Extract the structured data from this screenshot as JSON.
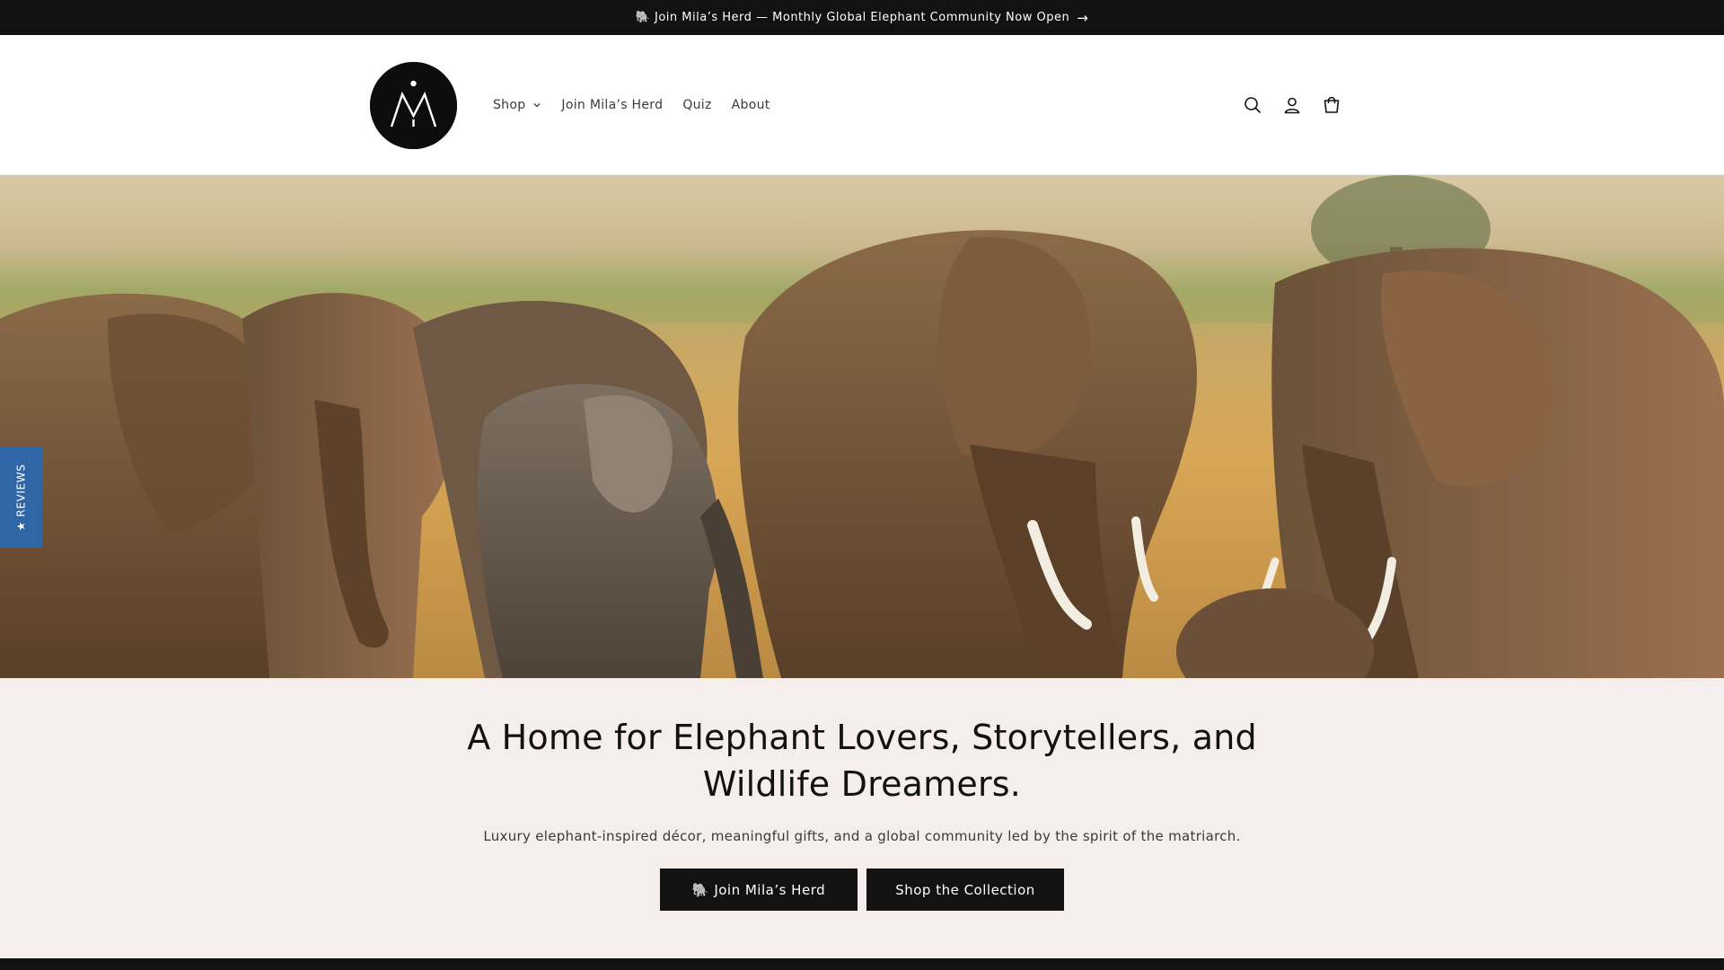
{
  "announcement": {
    "icon": "elephant-icon",
    "text": "🐘 Join Mila’s Herd — Monthly Global Elephant Community Now Open",
    "arrow": "→"
  },
  "header": {
    "logo_alt": "logo",
    "nav": [
      {
        "label": "Shop",
        "has_dropdown": true
      },
      {
        "label": "Join Mila’s Herd"
      },
      {
        "label": "Quiz"
      },
      {
        "label": "About"
      }
    ],
    "icons": [
      "search-icon",
      "account-icon",
      "cart-icon"
    ]
  },
  "hero": {
    "image": "herd of elephants on savanna",
    "colors": {
      "sky": "#d9c9a6",
      "grass": "#a9ab6d",
      "ground": "#d7a757",
      "elephant": "#7a5a3a"
    }
  },
  "reviews_tab": {
    "label": "★ REVIEWS",
    "color": "#2f66a6"
  },
  "content": {
    "headline": "A Home for Elephant Lovers, Storytellers, and Wildlife Dreamers.",
    "subhead": "Luxury elephant-inspired décor, meaningful gifts, and a global community led by the spirit of the matriarch.",
    "buttons": [
      {
        "label": "🐘 Join Mila’s Herd"
      },
      {
        "label": "Shop the Collection"
      }
    ],
    "background": "#f6eded"
  }
}
